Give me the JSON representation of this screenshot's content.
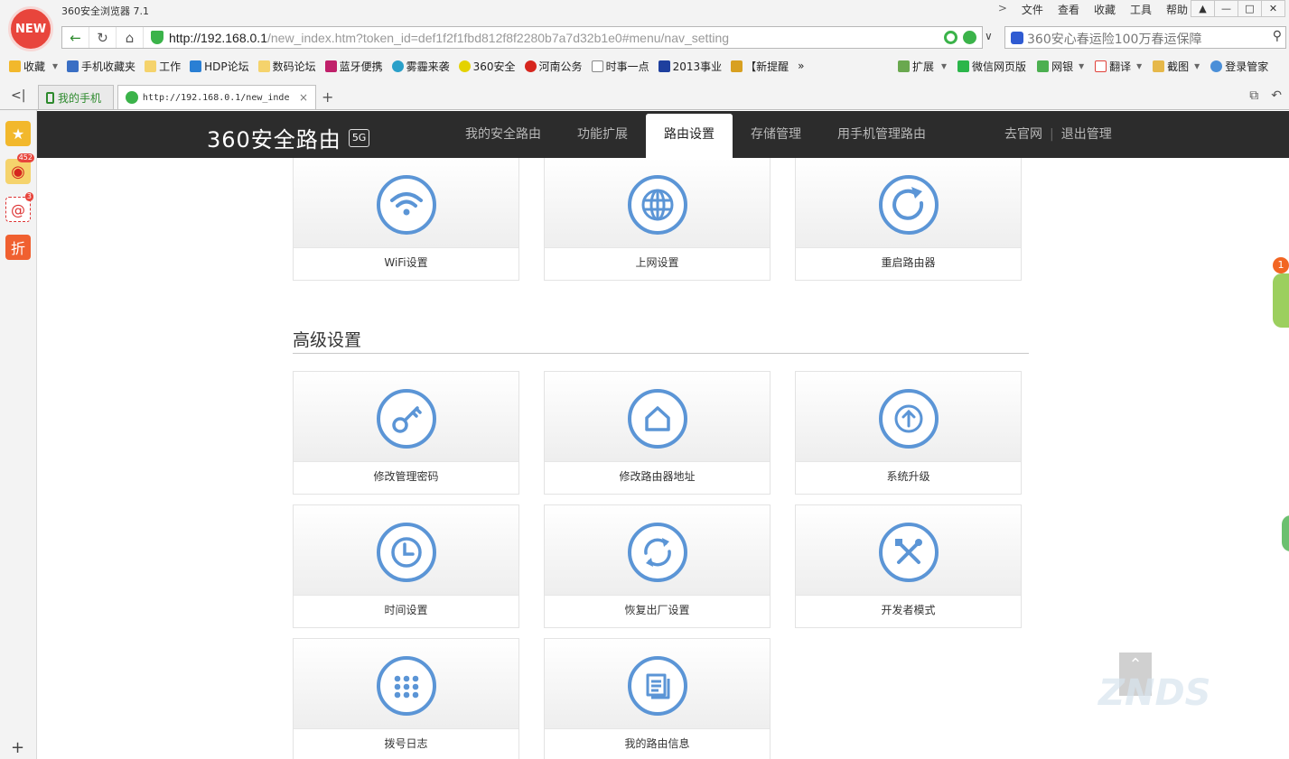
{
  "browser": {
    "logo": "NEW",
    "title": "360安全浏览器 7.1",
    "menu": [
      "文件",
      "查看",
      "收藏",
      "工具",
      "帮助"
    ],
    "url_host": "http://192.168.0.1",
    "url_path": "/new_index.htm?token_id=def1f2f1fbd812f8f2280b7a7d32b1e0#menu/nav_setting",
    "search_text": "360安心春运险100万春运保障",
    "bookmarks": [
      "收藏",
      "手机收藏夹",
      "工作",
      "HDP论坛",
      "数码论坛",
      "蓝牙便携",
      "雾霾来袭",
      "360安全",
      "河南公务",
      "时事一点",
      "2013事业",
      "【新提醒"
    ],
    "bookmarks_right": [
      "扩展",
      "微信网页版",
      "网银",
      "翻译",
      "截图",
      "登录管家"
    ],
    "tabs": [
      {
        "label": "我的手机"
      },
      {
        "label": "http://192.168.0.1/new_inde"
      }
    ],
    "sidebar_badges": {
      "weibo": "452",
      "mail": "3"
    },
    "sidebar_sale": "折"
  },
  "router": {
    "brand": "360安全路由",
    "brand_badge": "5G",
    "nav": [
      "我的安全路由",
      "功能扩展",
      "路由设置",
      "存储管理",
      "用手机管理路由"
    ],
    "active_nav": "路由设置",
    "links": [
      "去官网",
      "退出管理"
    ],
    "basic_cards": [
      {
        "label": "WiFi设置",
        "icon": "wifi-icon"
      },
      {
        "label": "上网设置",
        "icon": "globe-icon"
      },
      {
        "label": "重启路由器",
        "icon": "restart-icon"
      }
    ],
    "advanced_title": "高级设置",
    "advanced_cards": [
      {
        "label": "修改管理密码",
        "icon": "key-icon"
      },
      {
        "label": "修改路由器地址",
        "icon": "home-icon"
      },
      {
        "label": "系统升级",
        "icon": "upgrade-icon"
      },
      {
        "label": "时间设置",
        "icon": "clock-icon"
      },
      {
        "label": "恢复出厂设置",
        "icon": "reset-icon"
      },
      {
        "label": "开发者模式",
        "icon": "tools-icon"
      },
      {
        "label": "拨号日志",
        "icon": "dialpad-icon"
      },
      {
        "label": "我的路由信息",
        "icon": "document-icon"
      }
    ],
    "notification_count": "1",
    "watermark": "ZNDS"
  }
}
